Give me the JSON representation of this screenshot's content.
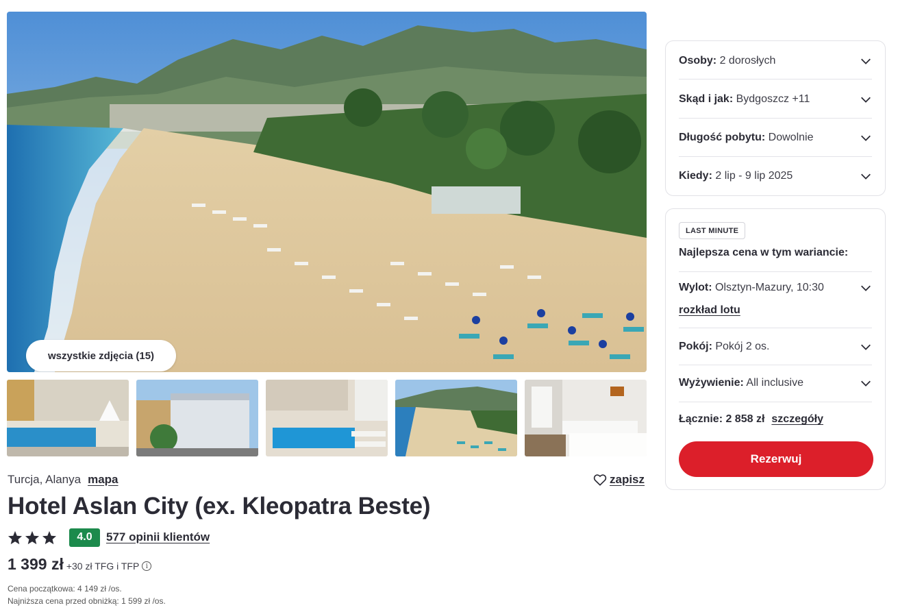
{
  "gallery": {
    "all_photos_label": "wszystkie zdjęcia (15)",
    "thumbnails": [
      "pool-courtyard",
      "hotel-building",
      "pool-loungers",
      "beach-aerial",
      "twin-room"
    ]
  },
  "hotel": {
    "location": "Turcja, Alanya",
    "map_link": "mapa",
    "save_label": "zapisz",
    "name": "Hotel Aslan City (ex. Kleopatra Beste)",
    "stars": 3,
    "score": "4.0",
    "reviews_link": "577 opinii klientów"
  },
  "price": {
    "main": "1 399 zł",
    "extra": "+30 zł TFG i TFP",
    "initial": "Cena początkowa: 4 149 zł /os.",
    "lowest_before": "Najniższa cena przed obniżką: 1 599 zł /os."
  },
  "search": {
    "persons_label": "Osoby:",
    "persons_value": "2 dorosłych",
    "from_label": "Skąd i jak:",
    "from_value": "Bydgoszcz +11",
    "length_label": "Długość pobytu:",
    "length_value": "Dowolnie",
    "when_label": "Kiedy:",
    "when_value": "2 lip - 9 lip 2025"
  },
  "offer": {
    "badge": "LAST MINUTE",
    "best_price_heading": "Najlepsza cena w tym wariancie:",
    "flight_label": "Wylot:",
    "flight_value": "Olsztyn-Mazury, 10:30",
    "flight_schedule_link": "rozkład lotu",
    "room_label": "Pokój:",
    "room_value": "Pokój 2 os.",
    "board_label": "Wyżywienie:",
    "board_value": "All inclusive",
    "total_label": "Łącznie: 2 858 zł",
    "details_link": "szczegóły",
    "reserve_button": "Rezerwuj"
  },
  "colors": {
    "accent_red": "#dc1f2a",
    "score_green": "#1c8a4c",
    "text_dark": "#2b2b35"
  }
}
